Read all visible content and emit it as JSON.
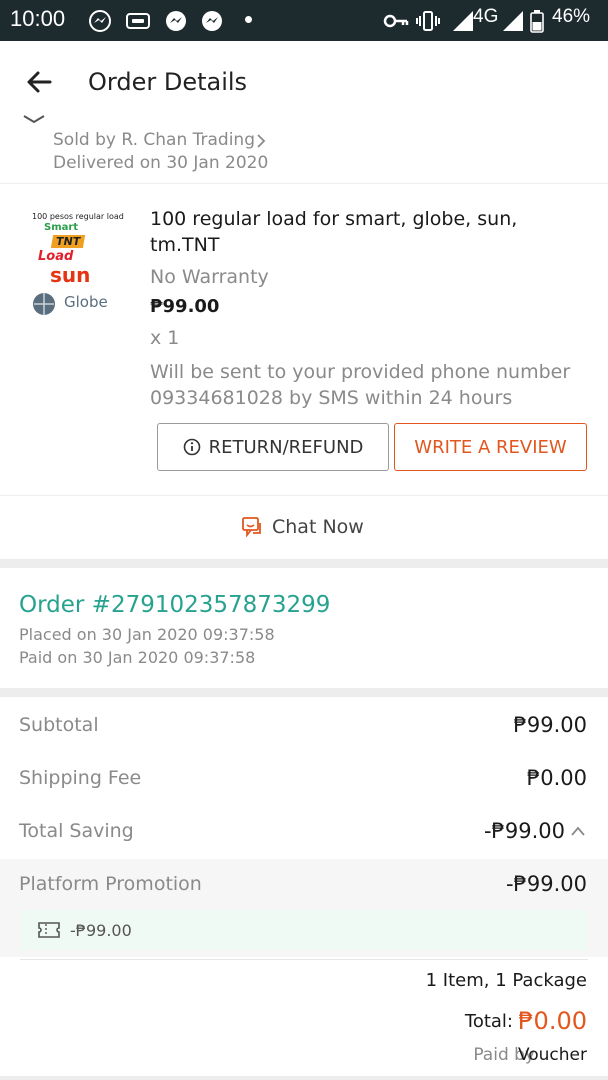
{
  "status_bar": {
    "time": "10:00",
    "network": "4G",
    "battery": "46%",
    "icons": [
      "messenger-icon",
      "link-card-icon",
      "messenger-icon",
      "messenger-icon",
      "key-icon",
      "vibrate-icon",
      "signal-icon",
      "signal-icon",
      "battery-icon"
    ]
  },
  "header": {
    "back_icon": "arrow-left-icon",
    "title": "Order Details"
  },
  "seller": {
    "sold_by": "Sold by R. Chan Trading",
    "delivered": "Delivered on 30 Jan 2020"
  },
  "product": {
    "thumb_caption": "100 pesos regular load",
    "thumb_brands": [
      "Smart",
      "TNT",
      "Load",
      "sun",
      "Globe"
    ],
    "name_line1": "100 regular load for smart, globe, sun,",
    "name_line2": "tm.TNT",
    "warranty": "No Warranty",
    "price": "₱99.00",
    "qty": "x 1",
    "note_line1": "Will be sent to your provided phone number",
    "note_line2": "09334681028 by SMS within 24 hours",
    "return_label": "RETURN/REFUND",
    "review_label": "WRITE A REVIEW"
  },
  "chat": {
    "label": "Chat Now"
  },
  "order": {
    "number": "Order #279102357873299",
    "placed": "Placed on 30 Jan 2020  09:37:58",
    "paid": "Paid on 30 Jan 2020  09:37:58"
  },
  "summary": {
    "subtotal_label": "Subtotal",
    "subtotal_value": "₱99.00",
    "shipping_label": "Shipping Fee",
    "shipping_value": "₱0.00",
    "saving_label": "Total Saving",
    "saving_value": "-₱99.00",
    "promo_label": "Platform Promotion",
    "promo_value": "-₱99.00",
    "voucher_value": "-₱99.00",
    "items": "1 Item, 1 Package",
    "total_label": "Total:",
    "total_value": "₱0.00",
    "paid_by_label": "Paid by",
    "paid_by_value": "Voucher"
  },
  "colors": {
    "accent_orange": "#e2571f",
    "order_green": "#27a28f",
    "status_bar": "#1d2a2e"
  }
}
